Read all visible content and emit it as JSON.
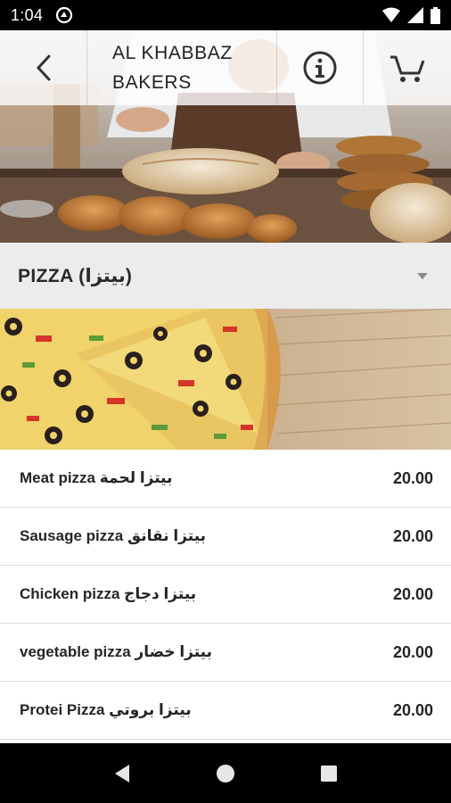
{
  "status_bar": {
    "time": "1:04",
    "icons": [
      "sync-icon",
      "wifi-icon",
      "signal-icon",
      "battery-icon"
    ]
  },
  "header": {
    "title_line1": "AL KHABBAZ",
    "title_line2": "BAKERS",
    "back_icon": "chevron-left-icon",
    "info_icon": "info-icon",
    "cart_icon": "cart-icon"
  },
  "category": {
    "title": "PIZZA (بيتزا)"
  },
  "menu": {
    "items": [
      {
        "name": "Meat pizza بيتزا لحمة",
        "price": "20.00"
      },
      {
        "name": "Sausage pizza بيتزا نقانق",
        "price": "20.00"
      },
      {
        "name": "Chicken pizza بيتزا دجاج",
        "price": "20.00"
      },
      {
        "name": "vegetable pizza بيتزا خضار",
        "price": "20.00"
      },
      {
        "name": "Protei Pizza بيتزا بروتي",
        "price": "20.00"
      }
    ]
  },
  "colors": {
    "status_bar_bg": "#000000",
    "header_overlay": "#ffffff",
    "category_bg": "#ececec",
    "text": "#252525"
  }
}
